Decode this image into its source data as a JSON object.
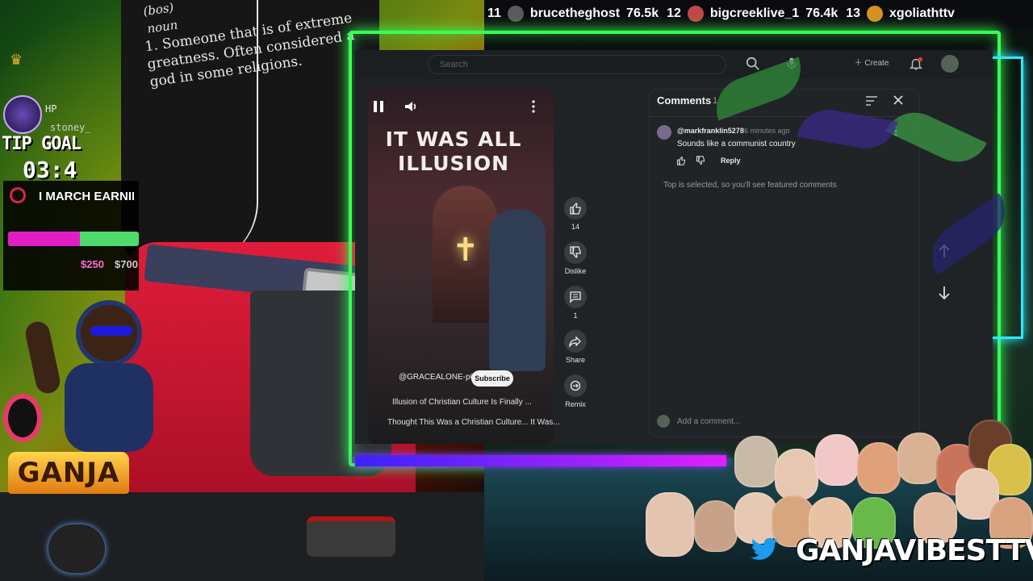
{
  "leaderboard": [
    {
      "rank": "11",
      "name": "brucetheghost",
      "score": "76.5k",
      "avatar_color": "#5a5a5a"
    },
    {
      "rank": "12",
      "name": "bigcreeklive_1",
      "score": "76.4k",
      "avatar_color": "#c04848"
    },
    {
      "rank": "13",
      "name": "xgoliathttv",
      "score": "",
      "avatar_color": "#d89020"
    }
  ],
  "shirt": {
    "pronunciation": "(bos)",
    "pos": "noun",
    "definition": "1. Someone that is of extreme greatness. Often considered a god in some religions."
  },
  "alerts": {
    "hp_label": "HP",
    "user": "stoney_",
    "tip_goal": "TIP GOAL",
    "timer": "03:4",
    "goal_title": "I MARCH EARNIN",
    "goal_progress": 0.55,
    "amount_current": "$250",
    "amount_target": "$700",
    "brand": "GANJA",
    "colors": {
      "fill": "#e21dc5",
      "track": "#4ddc6a"
    }
  },
  "youtube": {
    "search_placeholder": "Search",
    "create_label": "Create",
    "video": {
      "overlay_title": "IT WAS ALL ILLUSION",
      "channel": "@GRACEALONE-p6y4i",
      "subscribe": "Subscribe",
      "caption_line1": "Illusion of Christian Culture Is Finally ...",
      "caption_line2": "Thought This Was a Christian Culture... It Was..."
    },
    "actions": [
      {
        "icon": "thumbs-up-icon",
        "label": "14"
      },
      {
        "icon": "thumbs-down-icon",
        "label": "Dislike"
      },
      {
        "icon": "comment-icon",
        "label": "1"
      },
      {
        "icon": "share-icon",
        "label": "Share"
      },
      {
        "icon": "remix-icon",
        "label": "Remix"
      }
    ],
    "comments": {
      "title": "Comments",
      "count": "1",
      "items": [
        {
          "author": "@markfranklin5278",
          "time": "6 minutes ago",
          "text": "Sounds like a communist country",
          "reply": "Reply"
        }
      ],
      "featured_note": "Top is selected, so you'll see featured comments",
      "add_placeholder": "Add a comment..."
    }
  },
  "branding": {
    "channel": "GANJAVIBESTTV"
  }
}
